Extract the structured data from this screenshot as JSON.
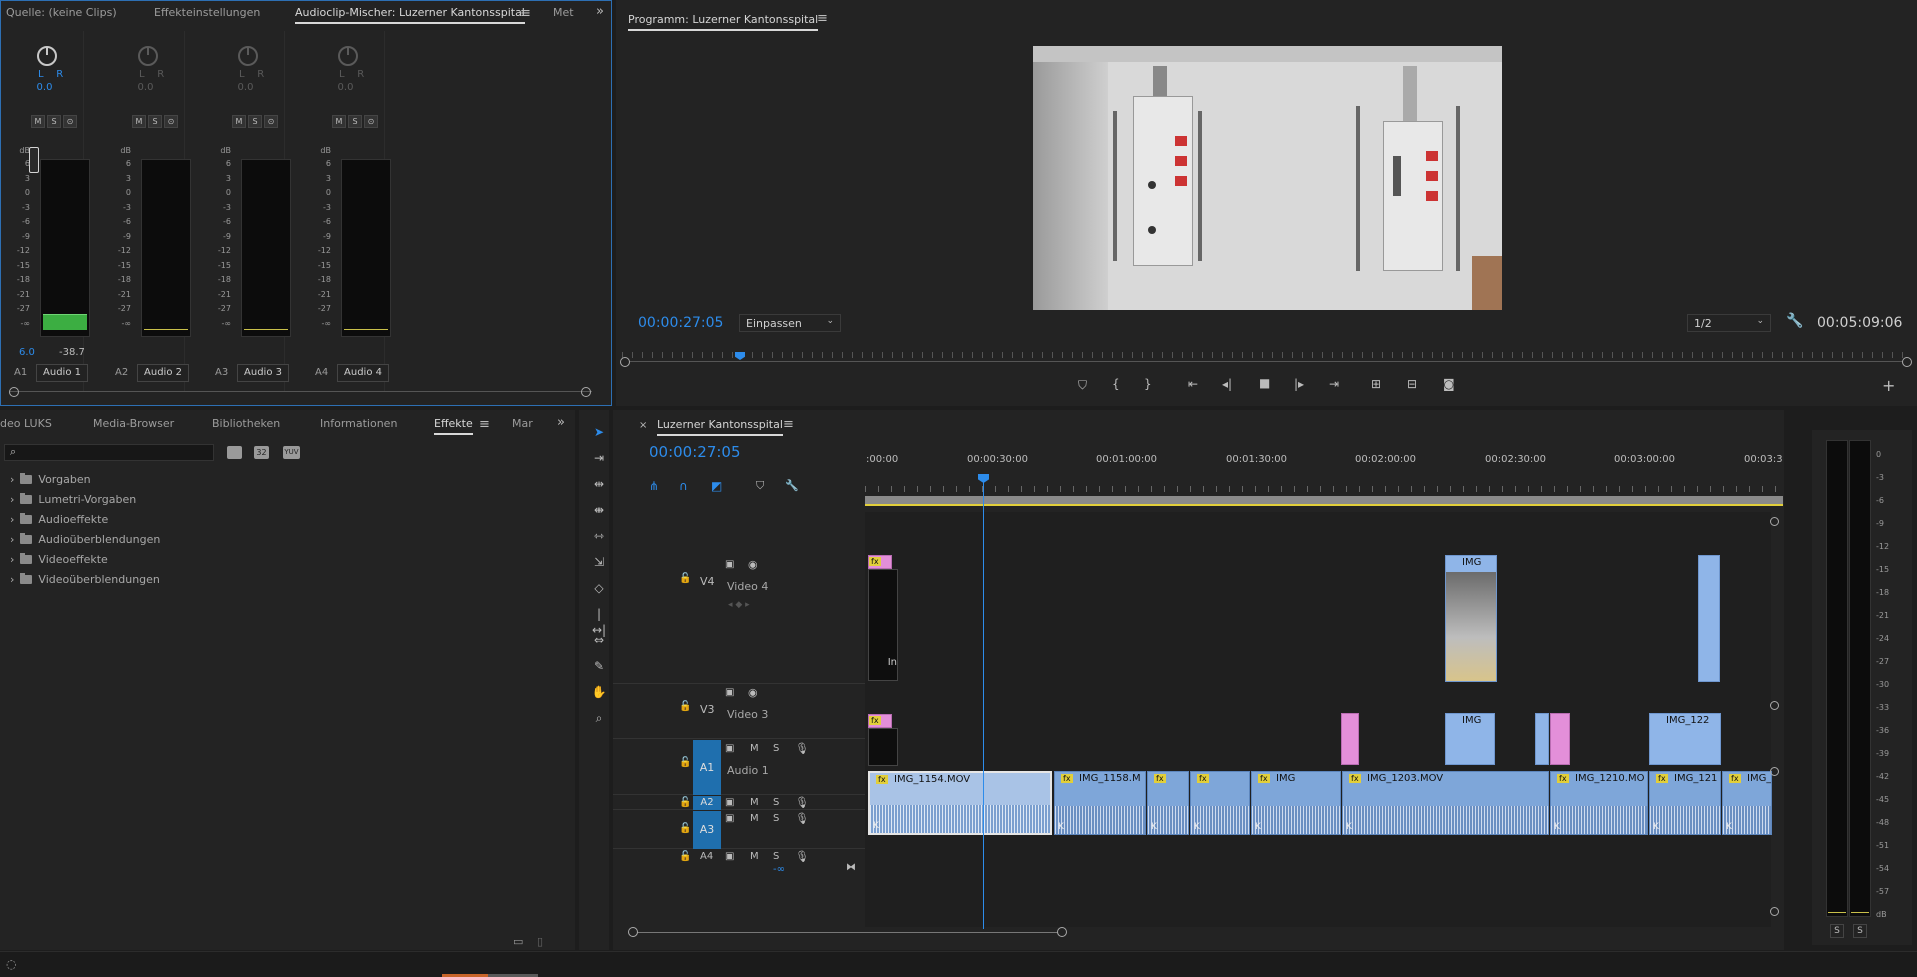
{
  "source_panel": {
    "tabs": [
      "Quelle: (keine Clips)",
      "Effekteinstellungen",
      "Audioclip-Mischer: Luzerner Kantonsspital",
      "Met"
    ],
    "overflow_icon": "double-chevron-right-icon",
    "db_label": "dB",
    "db_scale": [
      "6",
      "3",
      "0",
      "-3",
      "-6",
      "-9",
      "-12",
      "-15",
      "-18",
      "-21",
      "-27",
      "-∞"
    ],
    "channels": [
      {
        "id": "A1",
        "name": "Audio 1",
        "pan_l": "L",
        "pan_r": "R",
        "pan_value": "0.0",
        "m": "M",
        "s": "S",
        "r": "R",
        "active": true,
        "level_db": "6.0",
        "peak": "-38.7"
      },
      {
        "id": "A2",
        "name": "Audio 2",
        "pan_l": "L",
        "pan_r": "R",
        "pan_value": "0.0",
        "m": "M",
        "s": "S",
        "r": "R",
        "active": false
      },
      {
        "id": "A3",
        "name": "Audio 3",
        "pan_l": "L",
        "pan_r": "R",
        "pan_value": "0.0",
        "m": "M",
        "s": "S",
        "r": "R",
        "active": false
      },
      {
        "id": "A4",
        "name": "Audio 4",
        "pan_l": "L",
        "pan_r": "R",
        "pan_value": "0.0",
        "m": "M",
        "s": "S",
        "r": "R",
        "active": false
      }
    ]
  },
  "program": {
    "title": "Programm: Luzerner Kantonsspital",
    "timecode": "00:00:27:05",
    "fit_label": "Einpassen",
    "resolution": "1/2",
    "duration": "00:05:09:06",
    "playhead_fraction": 0.09
  },
  "effects_panel": {
    "tabs": [
      "deo LUKS",
      "Media-Browser",
      "Bibliotheken",
      "Informationen",
      "Effekte",
      "Mar"
    ],
    "active_tab": "Effekte",
    "search_placeholder": "",
    "bin_icons": [
      "accelerated-effects-icon",
      "32-bit-icon",
      "yuv-icon"
    ],
    "tree": [
      "Vorgaben",
      "Lumetri-Vorgaben",
      "Audioeffekte",
      "Audioüberblendungen",
      "Videoeffekte",
      "Videoüberblendungen"
    ]
  },
  "timeline": {
    "title": "Luzerner Kantonsspital",
    "timecode": "00:00:27:05",
    "ruler": [
      ":00:00",
      "00:00:30:00",
      "00:01:00:00",
      "00:01:30:00",
      "00:02:00:00",
      "00:02:30:00",
      "00:03:00:00",
      "00:03:3"
    ],
    "tracks": {
      "v4": {
        "id": "V4",
        "name": "Video 4"
      },
      "v3": {
        "id": "V3",
        "name": "Video 3"
      },
      "a1": {
        "id": "A1",
        "name": "Audio 1"
      },
      "a2": {
        "id": "A2"
      },
      "a3": {
        "id": "A3"
      },
      "a4": {
        "id": "A4"
      }
    },
    "m_label": "M",
    "s_label": "S",
    "neg_inf": "-∞",
    "v4_clip_text": "IMG",
    "v4_clip_partial": "In",
    "v3_clip_texts": [
      "IMG",
      "IMG_122"
    ],
    "fx_label": "fx",
    "k_label": "K",
    "audio_clips": [
      "IMG_1154.MOV",
      "IMG_1158.M",
      "IMG",
      "IMG_1203.MOV",
      "IMG_1210.MO",
      "IMG_121",
      "IMG_1"
    ]
  },
  "vu_meter": {
    "scale": [
      "0",
      "-3",
      "-6",
      "-9",
      "-12",
      "-15",
      "-18",
      "-21",
      "-24",
      "-27",
      "-30",
      "-33",
      "-36",
      "-39",
      "-42",
      "-45",
      "-48",
      "-51",
      "-54",
      "-57",
      "dB"
    ],
    "solo_labels": [
      "S",
      "S"
    ]
  }
}
